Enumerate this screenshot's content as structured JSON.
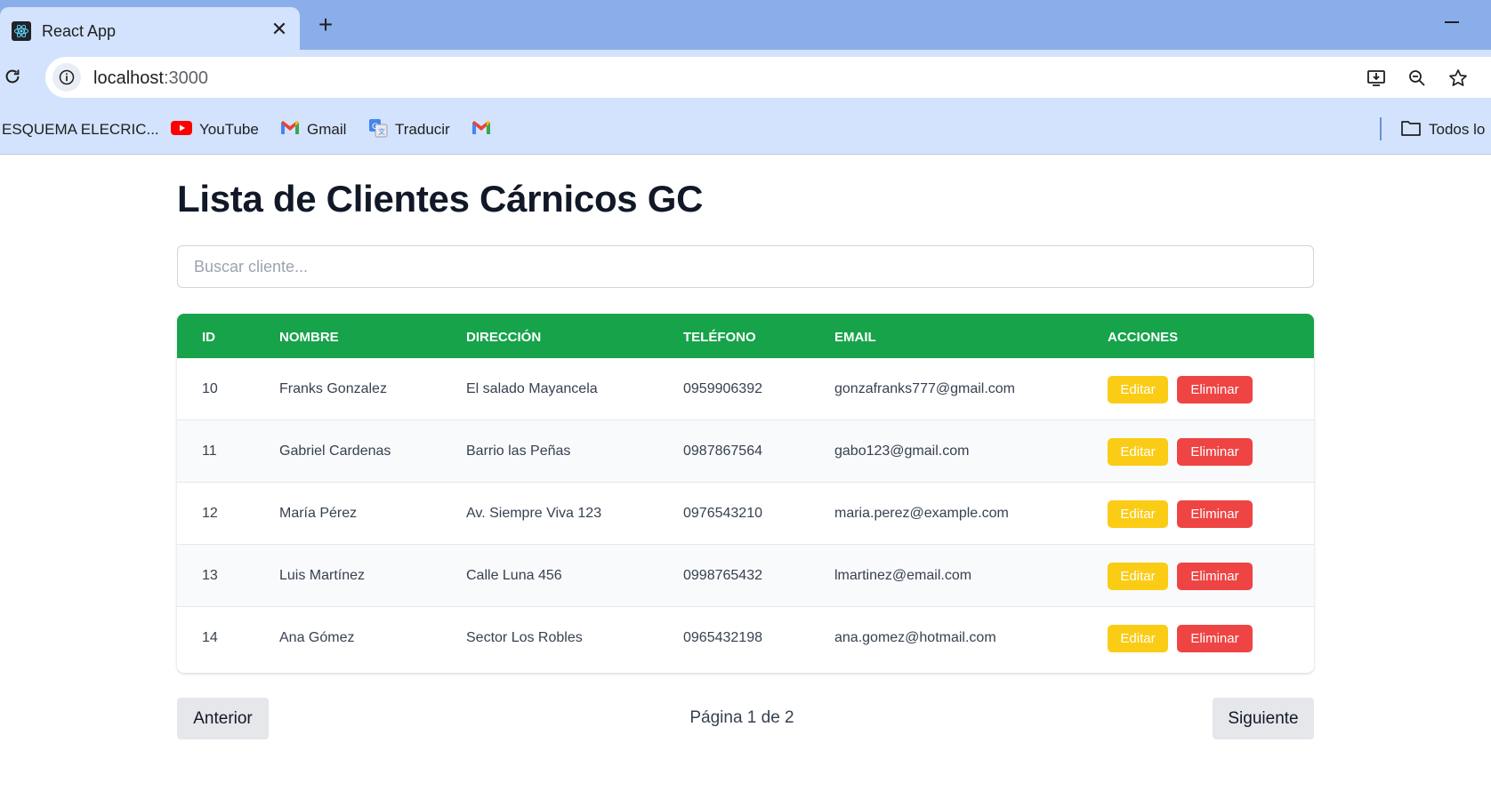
{
  "browser": {
    "tab_title": "React App",
    "url_host": "localhost",
    "url_port": ":3000",
    "bookmarks": [
      {
        "label": "ESQUEMA ELECRIC...",
        "icon": "none"
      },
      {
        "label": "YouTube",
        "icon": "youtube-icon"
      },
      {
        "label": "Gmail",
        "icon": "gmail-icon"
      },
      {
        "label": "Traducir",
        "icon": "translate-icon"
      },
      {
        "label": "",
        "icon": "gmail-icon"
      }
    ],
    "all_bookmarks_label": "Todos lo"
  },
  "page": {
    "title": "Lista de Clientes Cárnicos GC",
    "search_placeholder": "Buscar cliente...",
    "columns": [
      "ID",
      "Nombre",
      "Dirección",
      "Teléfono",
      "Email",
      "Acciones"
    ],
    "rows": [
      {
        "id": "10",
        "nombre": "Franks Gonzalez",
        "direccion": "El salado Mayancela",
        "telefono": "0959906392",
        "email": "gonzafranks777@gmail.com"
      },
      {
        "id": "11",
        "nombre": "Gabriel Cardenas",
        "direccion": "Barrio las Peñas",
        "telefono": "0987867564",
        "email": "gabo123@gmail.com"
      },
      {
        "id": "12",
        "nombre": "María Pérez",
        "direccion": "Av. Siempre Viva 123",
        "telefono": "0976543210",
        "email": "maria.perez@example.com"
      },
      {
        "id": "13",
        "nombre": "Luis Martínez",
        "direccion": "Calle Luna 456",
        "telefono": "0998765432",
        "email": "lmartinez@email.com"
      },
      {
        "id": "14",
        "nombre": "Ana Gómez",
        "direccion": "Sector Los Robles",
        "telefono": "0965432198",
        "email": "ana.gomez@hotmail.com"
      }
    ],
    "edit_label": "Editar",
    "delete_label": "Eliminar",
    "pagination": {
      "prev_label": "Anterior",
      "next_label": "Siguiente",
      "page_info": "Página 1 de 2"
    }
  },
  "colors": {
    "header_green": "#16a34a",
    "edit_yellow": "#facc15",
    "delete_red": "#ef4444",
    "chrome_blue": "#8aaee9"
  }
}
